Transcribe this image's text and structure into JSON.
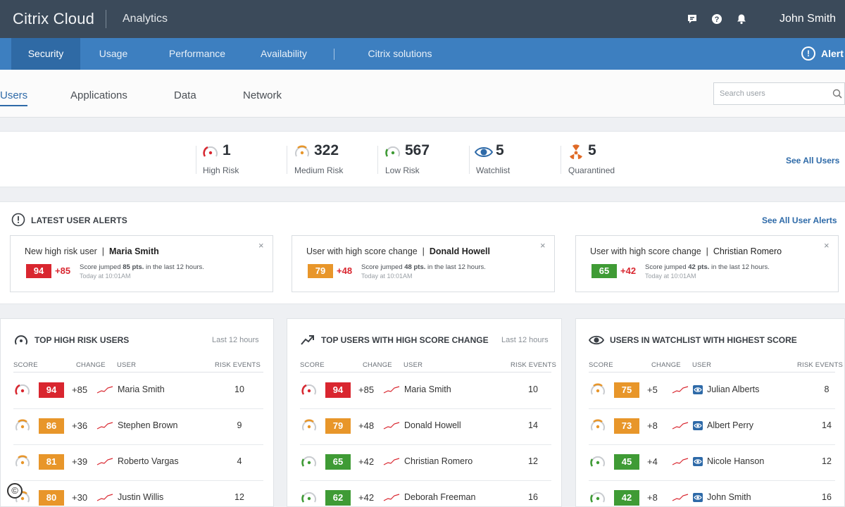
{
  "topbar": {
    "brand": "Citrix Cloud",
    "app": "Analytics",
    "user": "John Smith",
    "icons": [
      "chat-icon",
      "help-icon",
      "bell-icon"
    ]
  },
  "nav": {
    "items": [
      "Security",
      "Usage",
      "Performance",
      "Availability",
      "Citrix solutions"
    ],
    "active": "Security",
    "alerts_label": "Alert",
    "alerts_icon": "!"
  },
  "subtabs": {
    "items": [
      "Users",
      "Applications",
      "Data",
      "Network"
    ],
    "active": "Users",
    "search_placeholder": "Search users"
  },
  "stats": {
    "items": [
      {
        "value": "1",
        "label": "High Risk",
        "icon": "high-risk-gauge-icon"
      },
      {
        "value": "322",
        "label": "Medium Risk",
        "icon": "medium-risk-gauge-icon"
      },
      {
        "value": "567",
        "label": "Low Risk",
        "icon": "low-risk-gauge-icon"
      },
      {
        "value": "5",
        "label": "Watchlist",
        "icon": "eye-icon"
      },
      {
        "value": "5",
        "label": "Quarantined",
        "icon": "quarantine-icon"
      }
    ],
    "see_all": "See All Users"
  },
  "alerts": {
    "title": "LATEST USER ALERTS",
    "see_all": "See All User Alerts",
    "cards": [
      {
        "type": "New high risk user",
        "user": "Maria Smith",
        "score": "94",
        "delta": "+85",
        "detail_pre": "Score jumped ",
        "detail_pts": "85 pts.",
        "detail_post": " in the last 12 hours.",
        "time": "Today at 10:01AM"
      },
      {
        "type": "User with high score change",
        "user": "Donald Howell",
        "score": "79",
        "delta": "+48",
        "detail_pre": "Score jumped ",
        "detail_pts": "48 pts.",
        "detail_post": " in the last 12 hours.",
        "time": "Today at 10:01AM"
      },
      {
        "type": "User with high score change",
        "user": "Christian Romero",
        "score": "65",
        "delta": "+42",
        "detail_pre": "Score jumped ",
        "detail_pts": "42 pts.",
        "detail_post": " in the last 12 hours.",
        "time": "Today at 10:01AM"
      }
    ],
    "close": "×"
  },
  "columns": {
    "score": "SCORE",
    "change": "CHANGE",
    "user": "USER",
    "events": "RISK EVENTS"
  },
  "tables": [
    {
      "title": "TOP HIGH RISK USERS",
      "range": "Last 12 hours",
      "rows": [
        {
          "score": "94",
          "change": "+85",
          "user": "Maria Smith",
          "events": "10",
          "level": "high"
        },
        {
          "score": "86",
          "change": "+36",
          "user": "Stephen Brown",
          "events": "9",
          "level": "medium"
        },
        {
          "score": "81",
          "change": "+39",
          "user": "Roberto Vargas",
          "events": "4",
          "level": "medium"
        },
        {
          "score": "80",
          "change": "+30",
          "user": "Justin Willis",
          "events": "12",
          "level": "medium"
        }
      ]
    },
    {
      "title": "TOP USERS WITH HIGH SCORE CHANGE",
      "range": "Last 12 hours",
      "rows": [
        {
          "score": "94",
          "change": "+85",
          "user": "Maria Smith",
          "events": "10",
          "level": "high"
        },
        {
          "score": "79",
          "change": "+48",
          "user": "Donald Howell",
          "events": "14",
          "level": "medium"
        },
        {
          "score": "65",
          "change": "+42",
          "user": "Christian Romero",
          "events": "12",
          "level": "low"
        },
        {
          "score": "62",
          "change": "+42",
          "user": "Deborah Freeman",
          "events": "16",
          "level": "low"
        }
      ]
    },
    {
      "title": "USERS IN WATCHLIST WITH HIGHEST SCORE",
      "range": "",
      "rows": [
        {
          "score": "75",
          "change": "+5",
          "user": "Julian Alberts",
          "events": "8",
          "level": "medium"
        },
        {
          "score": "73",
          "change": "+8",
          "user": "Albert Perry",
          "events": "14",
          "level": "medium"
        },
        {
          "score": "45",
          "change": "+4",
          "user": "Nicole Hanson",
          "events": "12",
          "level": "low"
        },
        {
          "score": "42",
          "change": "+8",
          "user": "John Smith",
          "events": "16",
          "level": "low"
        }
      ]
    }
  ],
  "colors": {
    "high": "#d9262f",
    "medium": "#e8962a",
    "low": "#3f9b35",
    "accent": "#2e6aa8",
    "nav": "#3d7fc0",
    "topbar": "#3b4a5a"
  },
  "corner_mark": "©"
}
